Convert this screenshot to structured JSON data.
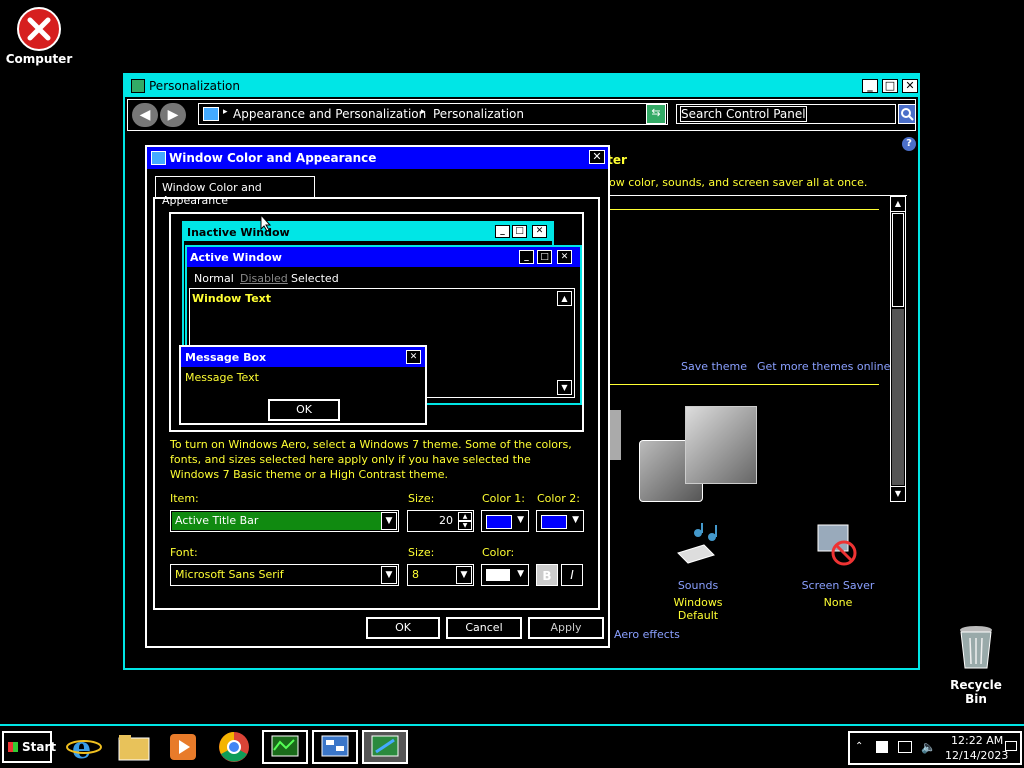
{
  "desktop": {
    "computer_label": "Computer",
    "recycle_label": "Recycle Bin"
  },
  "main_window": {
    "title": "Personalization",
    "breadcrumb_1": "Appearance and Personalization",
    "breadcrumb_2": "Personalization",
    "search_placeholder": "Search Control Panel",
    "heading_partial": "iter",
    "desc_partial": "ow color, sounds, and screen saver all at once.",
    "save_theme": "Save theme",
    "more_themes": "Get more themes online",
    "sounds_label": "Sounds",
    "sounds_value": "Windows Default",
    "screensaver_label": "Screen Saver",
    "screensaver_value": "None",
    "aero_effects": "Aero effects"
  },
  "dialog": {
    "title": "Window Color and Appearance",
    "tab": "Window Color and Appearance",
    "preview": {
      "inactive_title": "Inactive Window",
      "active_title": "Active Window",
      "menu_normal": "Normal",
      "menu_disabled": "Disabled",
      "menu_selected": "Selected",
      "window_text": "Window Text",
      "msg_title": "Message Box",
      "msg_text": "Message Text",
      "ok": "OK"
    },
    "info": "To turn on Windows Aero, select a Windows 7 theme.  Some of the colors, fonts, and sizes selected here apply only if you have selected the Windows 7 Basic theme or a High Contrast theme.",
    "item_label": "Item:",
    "item_value": "Active Title Bar",
    "size_label": "Size:",
    "size_value": "20",
    "color1_label": "Color 1:",
    "color2_label": "Color 2:",
    "font_label": "Font:",
    "font_value": "Microsoft Sans Serif",
    "font_size_label": "Size:",
    "font_size_value": "8",
    "font_color_label": "Color:",
    "bold": "B",
    "italic": "I",
    "ok": "OK",
    "cancel": "Cancel",
    "apply": "Apply"
  },
  "taskbar": {
    "start": "Start",
    "time": "12:22 AM",
    "date": "12/14/2023"
  },
  "colors": {
    "accent_cyan": "#00e6e6",
    "title_blue": "#0000ff",
    "text_yellow": "#ffff33",
    "link_blue": "#8aa0ff",
    "item_green": "#108a10"
  }
}
